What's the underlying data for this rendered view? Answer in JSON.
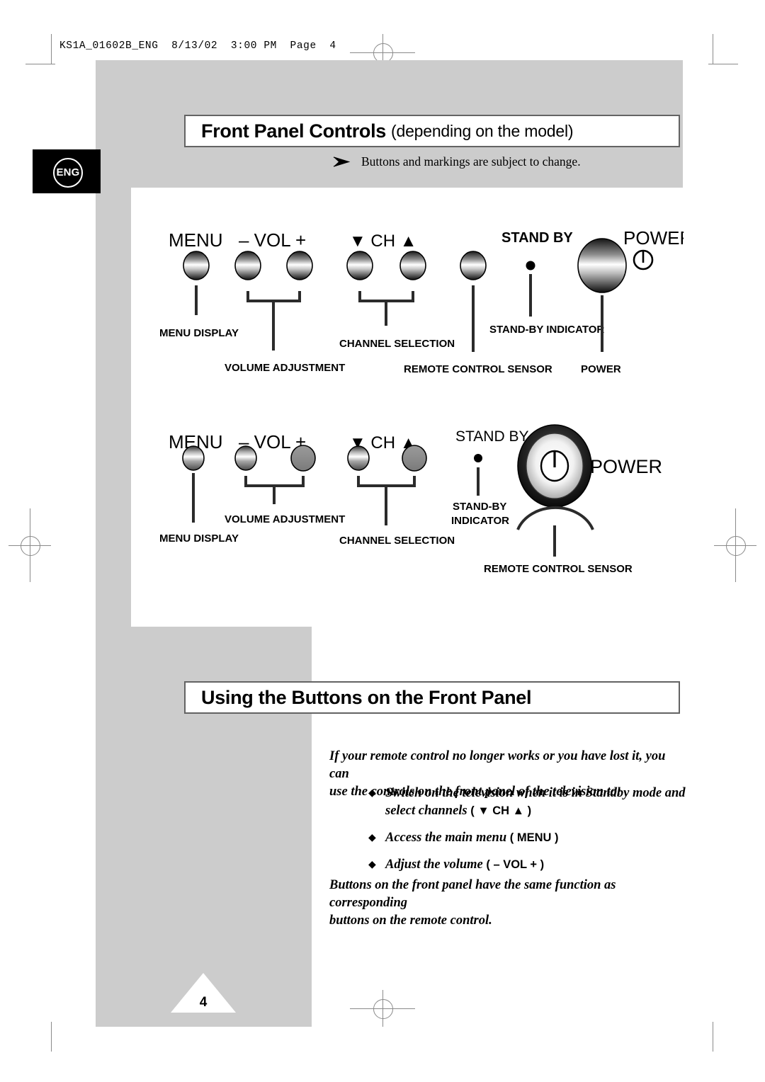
{
  "page": {
    "slug": "KS1A_01602B_ENG  8/13/02  3:00 PM  Page  4",
    "number": "4",
    "language_tab": "ENG",
    "colors": {
      "gray_background": "#cccccc",
      "bar_border": "#636363",
      "text": "#000000",
      "tab_background": "#000000"
    }
  },
  "sections": [
    {
      "title_main": "Front Panel Controls",
      "title_sub": "(depending on the model)",
      "note": "Buttons and markings are subject to change."
    },
    {
      "title_main": "Using the Buttons on the Front Panel",
      "title_sub": ""
    }
  ],
  "diagram_1": {
    "top_labels": [
      {
        "text": "MENU"
      },
      {
        "text": "– VOL +"
      },
      {
        "text": "▼ CH ▲"
      },
      {
        "text": "STAND BY"
      },
      {
        "text": "POWER"
      }
    ],
    "callouts": [
      {
        "text": "MENU DISPLAY"
      },
      {
        "text": "VOLUME ADJUSTMENT"
      },
      {
        "text": "CHANNEL SELECTION"
      },
      {
        "text": "STAND-BY INDICATOR"
      },
      {
        "text": "REMOTE CONTROL SENSOR"
      },
      {
        "text": "POWER"
      }
    ]
  },
  "diagram_2": {
    "top_labels": [
      {
        "text": "MENU"
      },
      {
        "text": "– VOL +"
      },
      {
        "text": "▼ CH ▲"
      },
      {
        "text": "STAND BY"
      },
      {
        "text": "POWER"
      }
    ],
    "callouts": [
      {
        "text": "VOLUME ADJUSTMENT"
      },
      {
        "text": "MENU DISPLAY"
      },
      {
        "text": "CHANNEL SELECTION"
      },
      {
        "text": "STAND-BY"
      },
      {
        "text": "INDICATOR"
      },
      {
        "text": "REMOTE CONTROL SENSOR"
      }
    ]
  },
  "body": {
    "intro_line_1": "If your remote control no longer works or you have lost it, you can",
    "intro_line_2": "use the controls on the front panel of the television to:",
    "bullets": [
      {
        "marker": "◆",
        "line_1": "Switch on the television when it is in Standby mode and",
        "line_2": "select channels",
        "button_ref": "( ▼ CH ▲ )"
      },
      {
        "marker": "◆",
        "line_1": "Access the main menu",
        "line_2": "",
        "button_ref": "( MENU )"
      },
      {
        "marker": "◆",
        "line_1": "Adjust the volume",
        "line_2": "",
        "button_ref": "( – VOL + )"
      }
    ],
    "closing_line_1": "Buttons on the front panel have the same function as corresponding",
    "closing_line_2": "buttons on the remote control."
  }
}
